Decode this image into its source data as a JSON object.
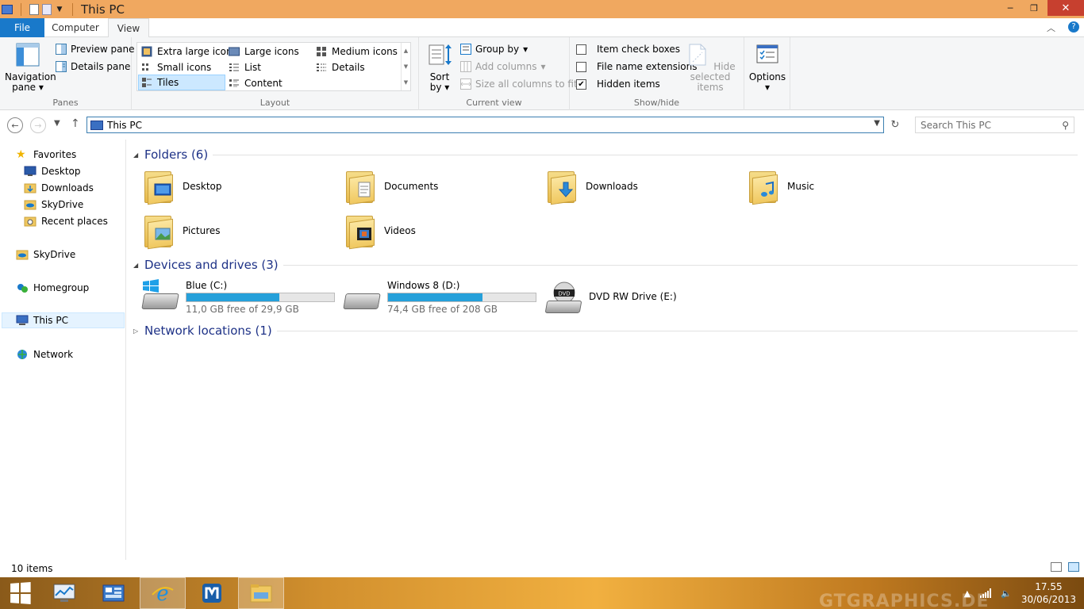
{
  "window": {
    "title": "This PC",
    "controls": {
      "minimize": "─",
      "maximize": "❐",
      "close": "✕"
    }
  },
  "ribbon_tabs": [
    "File",
    "Computer",
    "View"
  ],
  "ribbon": {
    "panes": {
      "group_label": "Panes",
      "navigation_pane": "Navigation pane",
      "preview_pane": "Preview pane",
      "details_pane": "Details pane"
    },
    "layout": {
      "group_label": "Layout",
      "items": [
        "Extra large icons",
        "Large icons",
        "Medium icons",
        "Small icons",
        "List",
        "Details",
        "Tiles",
        "Content"
      ],
      "selected": "Tiles"
    },
    "current_view": {
      "group_label": "Current view",
      "sort_by": "Sort by",
      "group_by": "Group by",
      "add_columns": "Add columns",
      "size_all_columns": "Size all columns to fit"
    },
    "show_hide": {
      "group_label": "Show/hide",
      "item_check_boxes": {
        "label": "Item check boxes",
        "checked": false
      },
      "file_name_extensions": {
        "label": "File name extensions",
        "checked": false
      },
      "hidden_items": {
        "label": "Hidden items",
        "checked": true
      },
      "hide_selected_items": "Hide selected items"
    },
    "options": "Options"
  },
  "address": {
    "path": "This PC",
    "search_placeholder": "Search This PC"
  },
  "navpane": {
    "favorites": "Favorites",
    "favorites_items": [
      "Desktop",
      "Downloads",
      "SkyDrive",
      "Recent places"
    ],
    "skydrive": "SkyDrive",
    "homegroup": "Homegroup",
    "this_pc": "This PC",
    "network": "Network"
  },
  "content": {
    "folders_header": "Folders (6)",
    "folders": [
      "Desktop",
      "Documents",
      "Downloads",
      "Music",
      "Pictures",
      "Videos"
    ],
    "devices_header": "Devices and drives (3)",
    "drives": [
      {
        "name": "Blue (C:)",
        "free": "11,0 GB free of 29,9 GB",
        "used_fraction": 0.63
      },
      {
        "name": "Windows 8 (D:)",
        "free": "74,4 GB free of 208 GB",
        "used_fraction": 0.64
      },
      {
        "name": "DVD RW Drive (E:)"
      }
    ],
    "network_header": "Network locations (1)"
  },
  "status": {
    "items": "10 items"
  },
  "taskbar": {
    "time": "17.55",
    "date": "30/06/2013",
    "watermark": "GTGRAPHICS.DE"
  },
  "colors": {
    "accent": "#1979ca",
    "titlebar": "#f0a860",
    "section_header": "#1e3287",
    "drive_bar": "#26a0da"
  }
}
